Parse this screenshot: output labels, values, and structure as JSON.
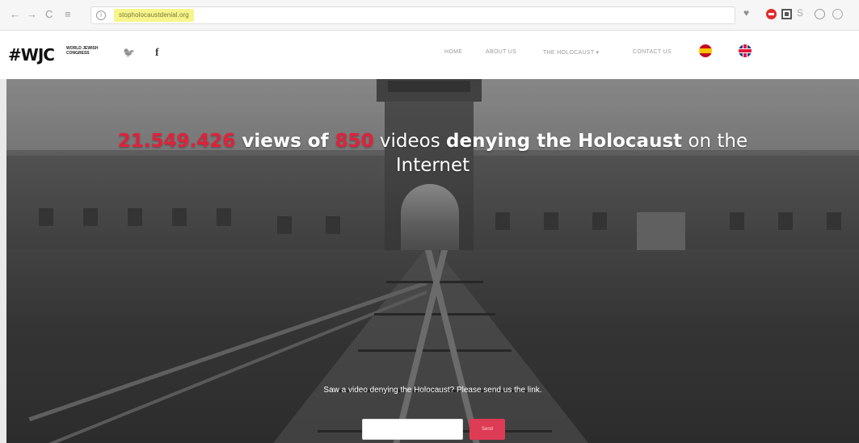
{
  "browser": {
    "back_glyph": "←",
    "forward_glyph": "→",
    "reload_glyph": "C",
    "page_glyph": "≡",
    "info_glyph": "i",
    "url": "stopholocaustdenial.org",
    "heart_glyph": "♥",
    "s_glyph": "S"
  },
  "header": {
    "logo_mark": "#WJC",
    "logo_text": "World Jewish Congress",
    "twitter_glyph": "🐦",
    "facebook_glyph": "f",
    "menu": {
      "home": "HOME",
      "about": "ABOUT US",
      "holocaust": "THE HOLOCAUST ▾",
      "contact": "CONTACT US"
    }
  },
  "hero": {
    "views_count": "21.549.426",
    "views_text": " views of ",
    "videos_count": "850",
    "videos_text": " videos ",
    "denying_text": "denying the Holocaust",
    "tail_text": " on the Internet",
    "cta_text": "Saw a video denying the Holocaust? Please send us the link.",
    "input_placeholder": "",
    "send_label": "Send"
  },
  "colors": {
    "accent_red": "#e0223a",
    "button_red": "#de3b54",
    "url_highlight": "#f7f48b"
  }
}
